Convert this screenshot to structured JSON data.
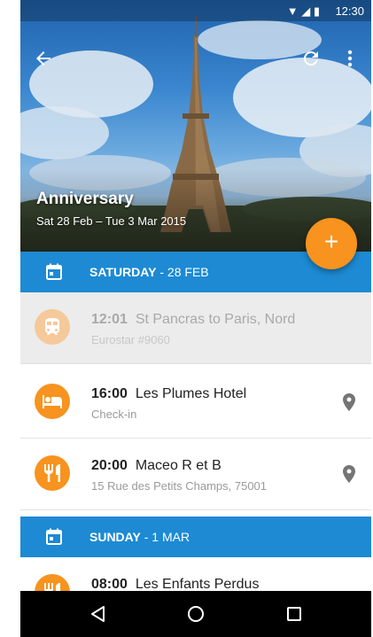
{
  "status_bar": {
    "time": "12:30",
    "icons": "▼ ◢ ▮"
  },
  "toolbar": {
    "back_icon": "arrow-left-icon",
    "refresh_icon": "refresh-icon",
    "more_icon": "more-vertical-icon"
  },
  "trip": {
    "title": "Anniversary",
    "dates": "Sat 28 Feb – Tue 3 Mar 2015"
  },
  "fab": {
    "label": "+"
  },
  "days": [
    {
      "day": "SATURDAY",
      "date": " - 28 FEB"
    },
    {
      "day": "SUNDAY",
      "date": " - 1 MAR"
    }
  ],
  "events": [
    {
      "time": "12:01",
      "title": "St Pancras to Paris, Nord",
      "subtitle": "Eurostar #9060",
      "icon": "train-icon",
      "past": true
    },
    {
      "time": "16:00",
      "title": "Les Plumes Hotel",
      "subtitle": "Check-in",
      "icon": "hotel-icon",
      "past": false
    },
    {
      "time": "20:00",
      "title": "Maceo R et B",
      "subtitle": "15 Rue des Petits Champs, 75001",
      "icon": "restaurant-icon",
      "past": false
    },
    {
      "time": "08:00",
      "title": "Les Enfants Perdus",
      "subtitle": "",
      "icon": "restaurant-icon",
      "past": false
    }
  ],
  "colors": {
    "accent": "#f7931e",
    "day_header": "#1d8ad3",
    "nav_bar": "#000000"
  }
}
